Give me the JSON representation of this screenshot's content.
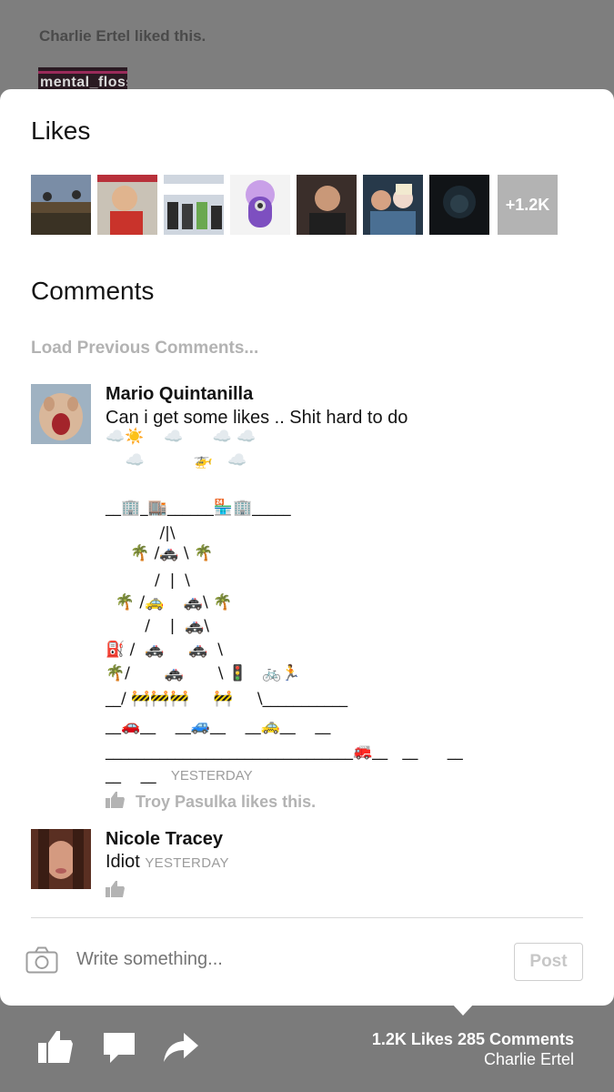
{
  "background": {
    "liked_text": "Charlie Ertel liked this.",
    "logo_text": "mental_floss"
  },
  "sheet": {
    "likes_title": "Likes",
    "more_likes": "+1.2K",
    "comments_title": "Comments",
    "load_previous": "Load Previous Comments..."
  },
  "comment1": {
    "author": "Mario Quintanilla",
    "text": "Can i get some likes .. Shit hard to do",
    "art": [
      "☁️☀️    ☁️      ☁️ ☁️",
      "    ☁️          🚁   ☁️",
      "",
      "__🏢_🏬______🏪🏢_____",
      "           /|\\",
      "     🌴 /🚓 \\ 🌴",
      "          /  |  \\",
      "  🌴 /🚕    🚓\\ 🌴",
      "        /    |  🚓\\",
      "⛽ /  🚓     🚓  \\",
      "🌴/       🚓       \\ 🚦   🚲🏃",
      "__/ 🚧🚧🚧     🚧     \\___________",
      "__🚗__    __🚙__    __🚕__    __",
      "________________________________🚒__   __      __"
    ],
    "last_line": "__    __",
    "time": "YESTERDAY",
    "like_note": "Troy Pasulka likes this."
  },
  "comment2": {
    "author": "Nicole Tracey",
    "text": "Idiot",
    "time": "YESTERDAY"
  },
  "composer": {
    "placeholder": "Write something...",
    "post_label": "Post"
  },
  "bottom_bar": {
    "likes_count": "1.2K Likes",
    "comments_count": "285 Comments",
    "owner": "Charlie Ertel"
  },
  "icons": [
    "camera-icon",
    "thumbs-up-icon",
    "comment-icon",
    "share-icon"
  ],
  "colors": {
    "overlay": "#7b7b7b",
    "muted_text": "#b3b3b3",
    "timestamp": "#9c9c9c"
  }
}
